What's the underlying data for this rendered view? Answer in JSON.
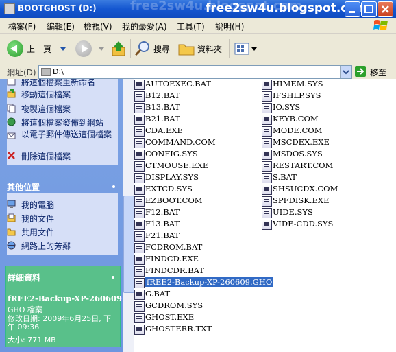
{
  "window": {
    "title": "BOOTGHOST (D:)",
    "watermark": "free2sw4u.blogspot.com",
    "url_overlay": "free2sw4u.blogspot.com"
  },
  "menu": [
    "檔案(F)",
    "編輯(E)",
    "檢視(V)",
    "我的最愛(A)",
    "工具(T)",
    "說明(H)"
  ],
  "toolbar": {
    "back_label": "上一頁",
    "search_label": "搜尋",
    "folders_label": "資料夾"
  },
  "address": {
    "label": "網址(D)",
    "value": "D:\\",
    "go_label": "移至"
  },
  "tasks": [
    {
      "label": "將這個檔案重新命名",
      "icon": "rename-icon"
    },
    {
      "label": "移動這個檔案",
      "icon": "move-icon"
    },
    {
      "label": "複製這個檔案",
      "icon": "copy-icon"
    },
    {
      "label": "將這個檔案發佈到網站",
      "icon": "publish-icon"
    },
    {
      "label": "以電子郵件傳送這個檔案",
      "icon": "email-icon"
    },
    {
      "label": "刪除這個檔案",
      "icon": "delete-icon"
    }
  ],
  "other_places": {
    "title": "其他位置",
    "items": [
      {
        "label": "我的電腦",
        "icon": "computer-icon"
      },
      {
        "label": "我的文件",
        "icon": "documents-icon"
      },
      {
        "label": "共用文件",
        "icon": "shared-folder-icon"
      },
      {
        "label": "網路上的芳鄰",
        "icon": "network-icon"
      }
    ]
  },
  "details": {
    "title": "詳細資料",
    "filename": "fREE2-Backup-XP-260609",
    "type": "GHO 檔案",
    "modified": "修改日期: 2009年6月25日, 下午 09:36",
    "size": "大小: 771 MB"
  },
  "files_col1": [
    "AUTOEXEC.BAT",
    "B12.BAT",
    "B13.BAT",
    "B21.BAT",
    "CDA.EXE",
    "COMMAND.COM",
    "CONFIG.SYS",
    "CTMOUSE.EXE",
    "DISPLAY.SYS",
    "EXTCD.SYS",
    "EZBOOT.COM",
    "F12.BAT",
    "F13.BAT",
    "F21.BAT",
    "FCDROM.BAT",
    "FINDCD.EXE",
    "FINDCDR.BAT",
    "fREE2-Backup-XP-260609.GHO",
    "G.BAT",
    "GCDROM.SYS",
    "GHOST.EXE",
    "GHOSTERR.TXT"
  ],
  "files_col2": [
    "HIMEM.SYS",
    "IFSHLP.SYS",
    "IO.SYS",
    "KEYB.COM",
    "MODE.COM",
    "MSCDEX.EXE",
    "MSDOS.SYS",
    "RESTART.COM",
    "S.BAT",
    "SHSUCDX.COM",
    "SPFDISK.EXE",
    "UIDE.SYS",
    "VIDE-CDD.SYS"
  ],
  "selected_file": "fREE2-Backup-XP-260609.GHO"
}
